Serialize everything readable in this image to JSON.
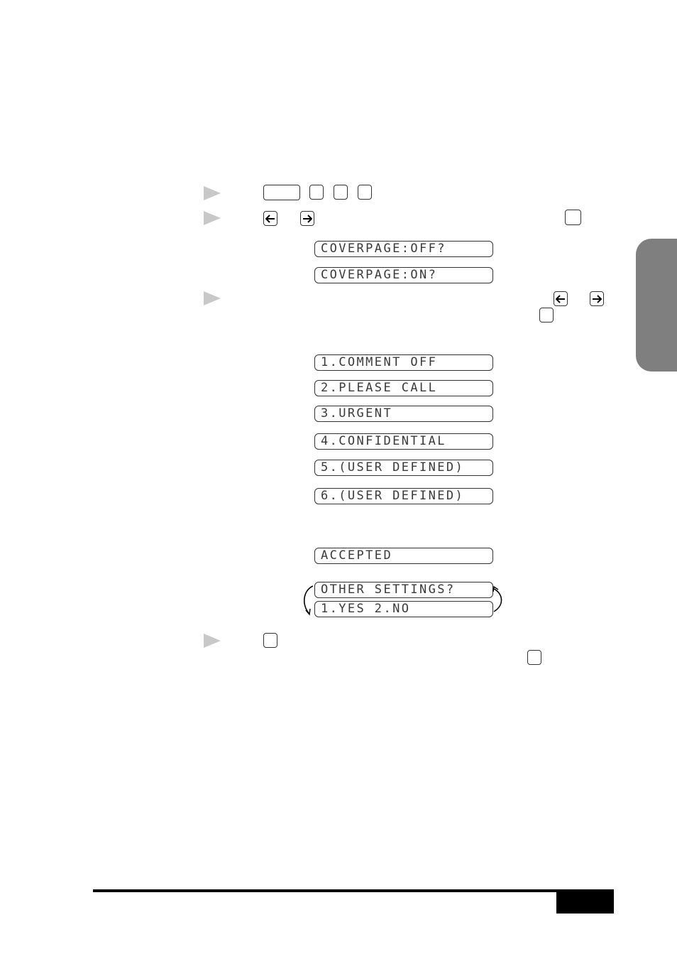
{
  "document": {
    "type": "fax machine manual page",
    "section_tab_color": "#7f7f7f"
  },
  "steps": [
    {
      "id": 1,
      "marker": "step-arrow",
      "keys": [
        "function-key",
        "digit-key",
        "digit-key",
        "digit-key"
      ]
    },
    {
      "id": 2,
      "marker": "step-arrow",
      "keys": [
        "left-arrow-key",
        "right-arrow-key",
        "set-key"
      ]
    },
    {
      "id": 3,
      "marker": "step-arrow",
      "keys": [
        "left-arrow-key",
        "right-arrow-key",
        "set-key"
      ]
    },
    {
      "id": 4,
      "marker": "step-arrow",
      "keys": [
        "digit-key",
        "stop-key"
      ]
    }
  ],
  "lcd": {
    "coverpage_off": "COVERPAGE:OFF?",
    "coverpage_on": "COVERPAGE:ON?",
    "comments": [
      "1.COMMENT OFF",
      "2.PLEASE CALL",
      "3.URGENT",
      "4.CONFIDENTIAL",
      "5.(USER DEFINED)",
      "6.(USER DEFINED)"
    ],
    "accepted": "ACCEPTED",
    "other_settings": "OTHER SETTINGS?",
    "yes_no": "1.YES 2.NO"
  },
  "icons": {
    "step_marker": "triangle-right",
    "left_arrow": "arrow-left",
    "right_arrow": "arrow-right",
    "cycle": "cycle-arrows"
  }
}
